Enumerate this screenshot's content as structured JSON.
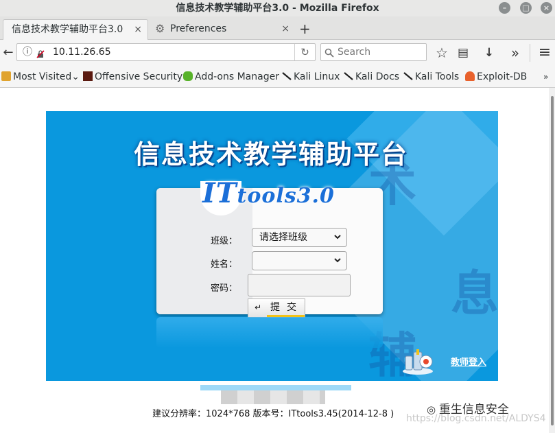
{
  "window": {
    "title": "信息技术教学辅助平台3.0 - Mozilla Firefox",
    "minimize": "–",
    "maximize": "□",
    "close": "×"
  },
  "tabs": [
    {
      "label": "信息技术教学辅助平台3.0",
      "close": "×",
      "active": true
    },
    {
      "label": "Preferences",
      "close": "×",
      "icon": "gear-icon",
      "active": false
    }
  ],
  "newtab": "+",
  "nav": {
    "back": "←",
    "info": "ⓘ",
    "url": "10.11.26.65",
    "reload": "↻",
    "search_placeholder": "Search",
    "star": "☆",
    "library": "▤",
    "download": "↓",
    "overflow": "»",
    "menu": "≡"
  },
  "bookmarks": [
    {
      "label": "Most Visited",
      "icon": "folder-icon",
      "suffix": "⌄"
    },
    {
      "label": "Offensive Security",
      "icon": "offsec-icon"
    },
    {
      "label": "Add-ons Manager",
      "icon": "puzzle-icon"
    },
    {
      "label": "Kali Linux",
      "icon": "kali-icon"
    },
    {
      "label": "Kali Docs",
      "icon": "kali-icon"
    },
    {
      "label": "Kali Tools",
      "icon": "kali-icon"
    },
    {
      "label": "Exploit-DB",
      "icon": "exploitdb-icon"
    }
  ],
  "bookmarks_overflow": "»",
  "page": {
    "platform_title": "信息技术教学辅助平台",
    "logo_main": "IT",
    "logo_rest": "tools3.0",
    "form": {
      "class_label": "班级：",
      "class_value": "请选择班级",
      "name_label": "姓名：",
      "name_value": "",
      "password_label": "密码：",
      "submit_label": "提交",
      "submit_arrow": "↵"
    },
    "teacher_login": "教师登入",
    "footer": "建议分辨率：1024*768 版本号：ITtools3.45(2014-12-8 )",
    "watermark": "重生信息安全",
    "watermark_url": "https://blog.csdn.net/ALDYS4"
  },
  "colors": {
    "stage_bg": "#0a98de",
    "submit_accent": "#f3c317"
  }
}
